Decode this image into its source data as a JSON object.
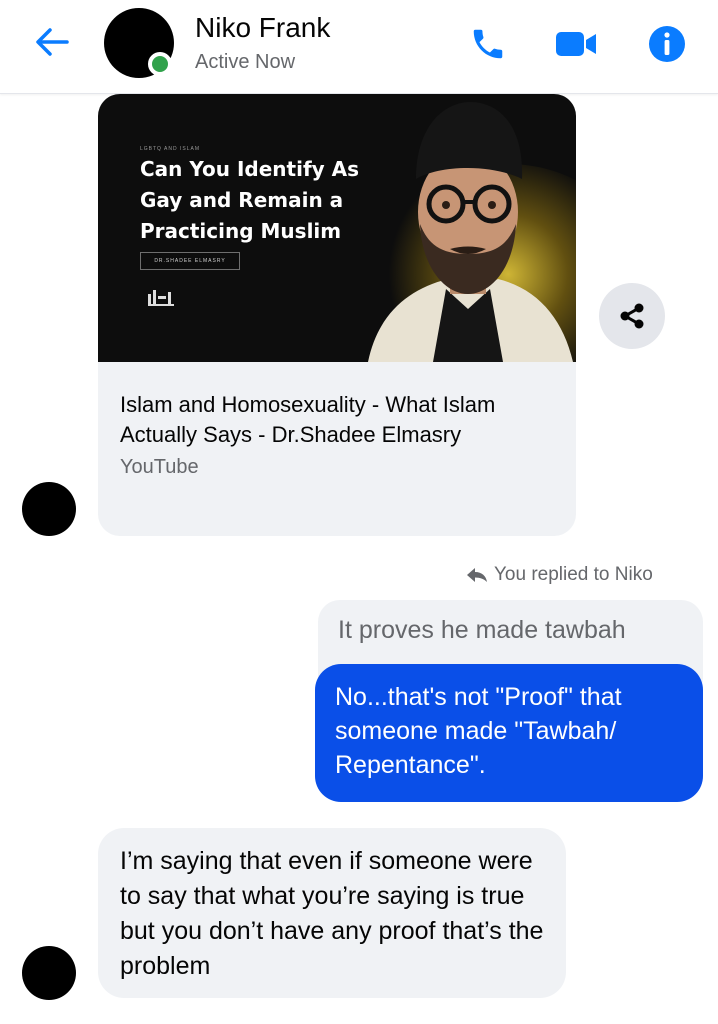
{
  "header": {
    "contact_name": "Niko Frank",
    "status": "Active Now",
    "icons": [
      "back-arrow-icon",
      "phone-icon",
      "video-camera-icon",
      "info-icon"
    ],
    "accent_color": "#0a7cff"
  },
  "shared_link": {
    "thumbnail": {
      "kicker": "LGBTQ AND ISLAM",
      "title": "Can You Identify As Gay and Remain a Practicing Muslim",
      "byline": "DR.SHADEE ELMASRY"
    },
    "title": "Islam and Homosexuality - What Islam Actually Says - Dr.Shadee Elmasry",
    "source": "YouTube"
  },
  "messages": {
    "reply_indicator": "You replied to Niko",
    "quoted_text": "It proves he made tawbah",
    "sent_text": "No...that's not \"Proof\" that someone made \"Tawbah/ Repentance\".",
    "received_text": "I’m saying that even if someone were to say that what you’re saying is true but you don’t have any proof that’s the problem"
  },
  "colors": {
    "sent_bubble": "#0a4fe8",
    "received_bubble": "#f0f2f5",
    "online": "#31a24c"
  }
}
